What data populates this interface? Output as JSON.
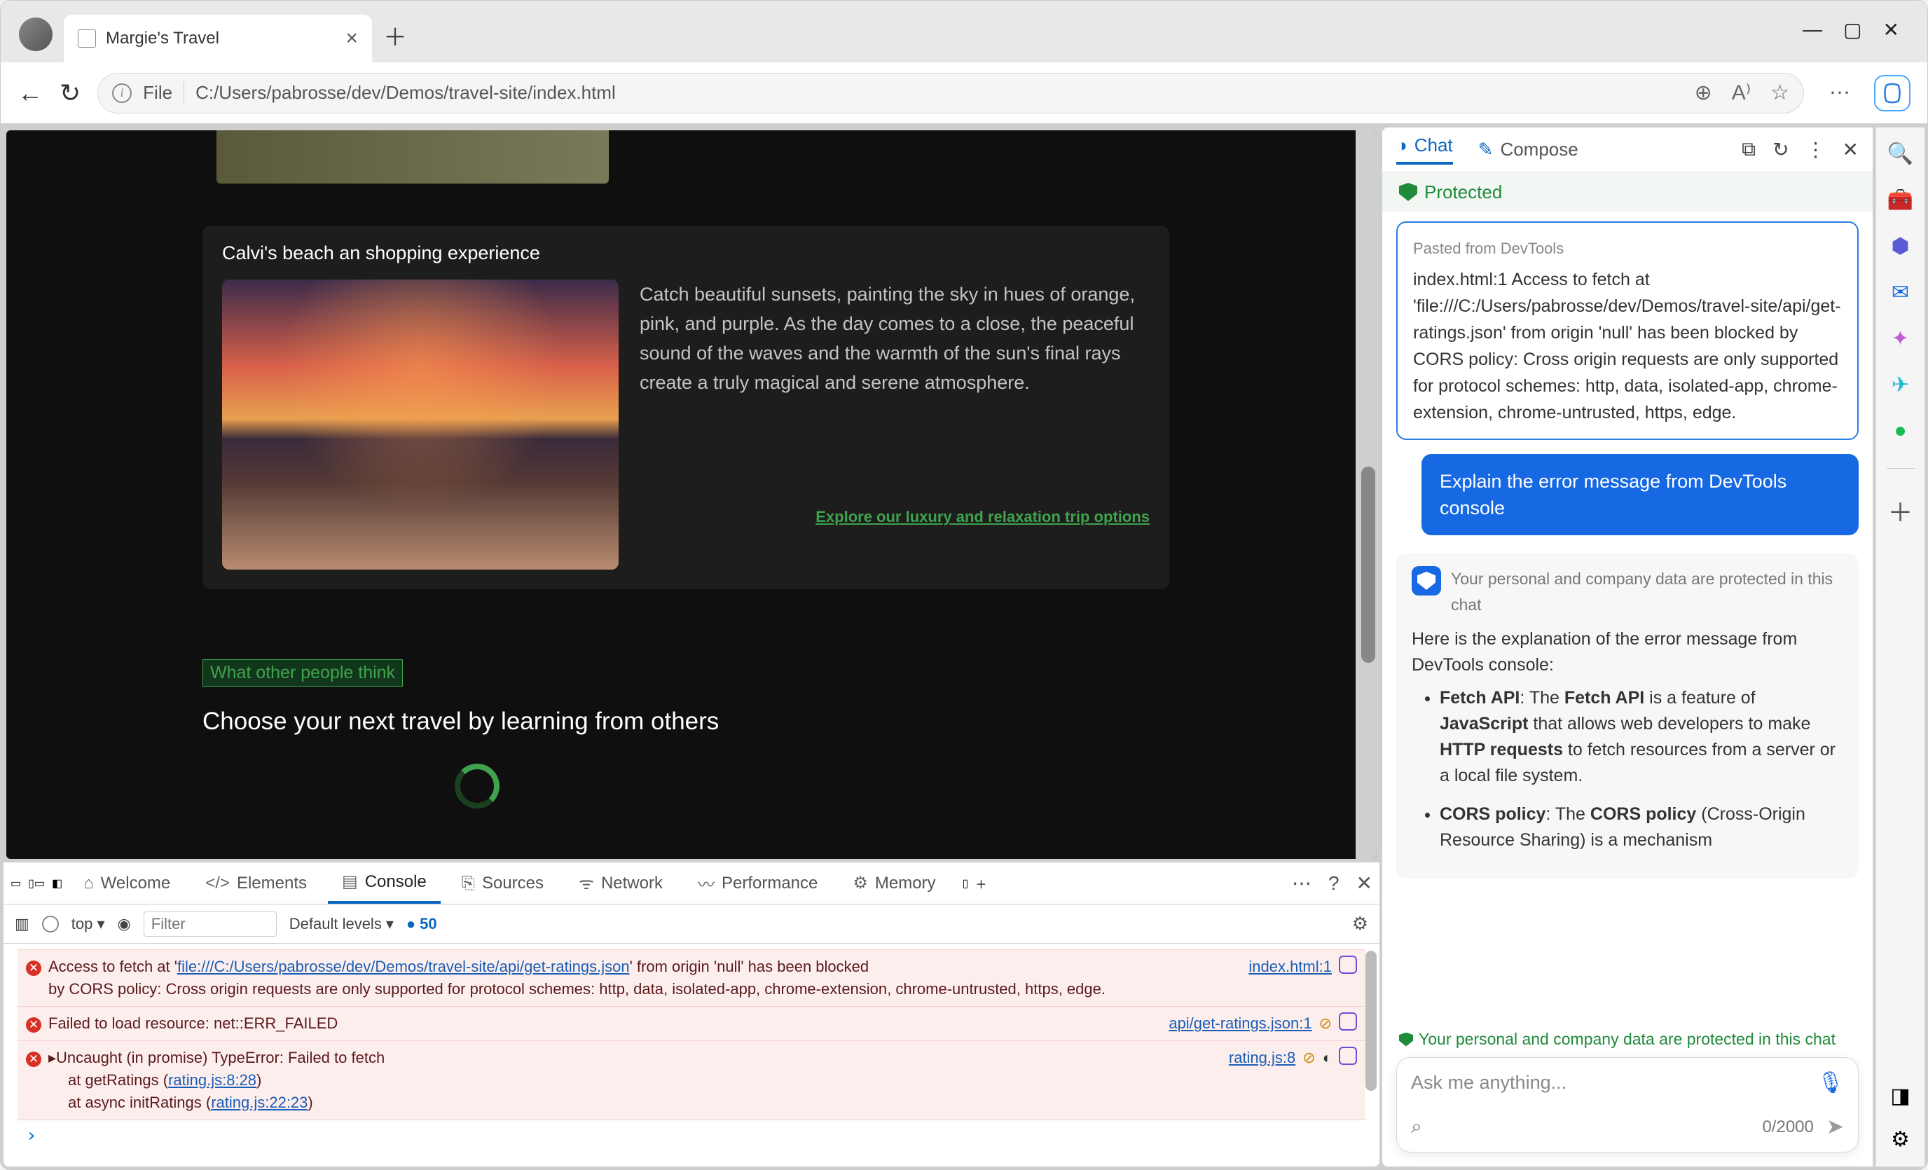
{
  "browser": {
    "tab_title": "Margie's Travel",
    "url_protocol": "File",
    "url_path": "C:/Users/pabrosse/dev/Demos/travel-site/index.html"
  },
  "page": {
    "card_title": "Calvi's beach an shopping experience",
    "card_text": "Catch beautiful sunsets, painting the sky in hues of orange, pink, and purple. As the day comes to a close, the peaceful sound of the waves and the warmth of the sun's final rays create a truly magical and serene atmosphere.",
    "card_link": "Explore our luxury and relaxation trip options",
    "badge": "What other people think",
    "heading": "Choose your next travel by learning from others"
  },
  "devtools": {
    "tabs": [
      "Welcome",
      "Elements",
      "Console",
      "Sources",
      "Network",
      "Performance",
      "Memory"
    ],
    "active_tab": "Console",
    "context": "top",
    "filter_placeholder": "Filter",
    "levels": "Default levels",
    "info_count": "50",
    "messages": {
      "e1_pre": "Access to fetch at '",
      "e1_url": "file:///C:/Users/pabrosse/dev/Demos/travel-site/api/get-ratings.json",
      "e1_mid": "' from origin 'null' has been blocked",
      "e1_post": "by CORS policy: Cross origin requests are only supported for protocol schemes: http, data, isolated-app, chrome-extension, chrome-untrusted, https, edge.",
      "e1_src": "index.html:1",
      "e2": "Failed to load resource: net::ERR_FAILED",
      "e2_src": "api/get-ratings.json:1",
      "e3_head": "▸Uncaught (in promise) TypeError: Failed to fetch",
      "e3_s1_pre": "at getRatings (",
      "e3_s1_link": "rating.js:8:28",
      "e3_s1_post": ")",
      "e3_s2_pre": "at async initRatings (",
      "e3_s2_link": "rating.js:22:23",
      "e3_s2_post": ")",
      "e3_src": "rating.js:8"
    }
  },
  "copilot": {
    "tabs": {
      "chat": "Chat",
      "compose": "Compose"
    },
    "protected": "Protected",
    "pasted_hint": "Pasted from DevTools",
    "pasted_body": "index.html:1 Access to fetch at 'file:///C:/Users/pabrosse/dev/Demos/travel-site/api/get-ratings.json' from origin 'null' has been blocked by CORS policy: Cross origin requests are only supported for protocol schemes: http, data, isolated-app, chrome-extension, chrome-untrusted, https, edge.",
    "suggest": "Explain the error message from DevTools console",
    "privacy_inline": "Your personal and company data are protected in this chat",
    "answer_intro": "Here is the explanation of the error message from DevTools console:",
    "bullet1_a": "Fetch API",
    "bullet1_b": ": The ",
    "bullet1_c": "Fetch API",
    "bullet1_d": " is a feature of ",
    "bullet1_e": "JavaScript",
    "bullet1_f": " that allows web developers to make ",
    "bullet1_g": "HTTP requests",
    "bullet1_h": " to fetch resources from a server or a local file system.",
    "bullet2_a": "CORS policy",
    "bullet2_b": ": The ",
    "bullet2_c": "CORS policy",
    "bullet2_d": " (Cross-Origin Resource Sharing) is a mechanism",
    "foot_note": "Your personal and company data are protected in this chat",
    "input_placeholder": "Ask me anything...",
    "counter": "0/2000"
  }
}
